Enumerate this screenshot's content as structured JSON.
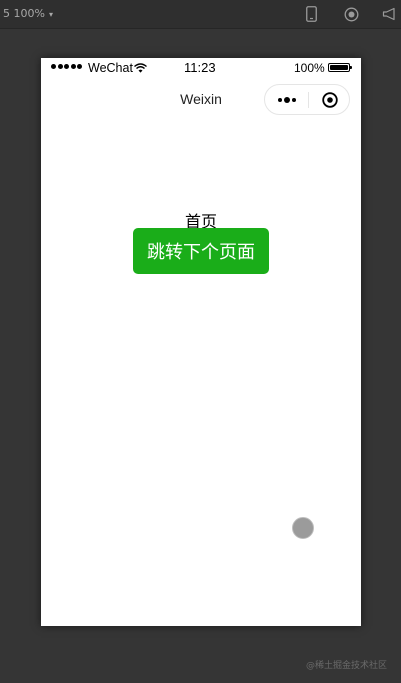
{
  "toolbar": {
    "zoom_label": "5 100%",
    "zoom_caret": "▾",
    "phone_icon": "phone-icon",
    "record_icon": "record-icon",
    "speaker_icon": "speaker-icon"
  },
  "statusbar": {
    "carrier": "WeChat",
    "time": "11:23",
    "battery_percent": "100%"
  },
  "navbar": {
    "title": "Weixin"
  },
  "page": {
    "heading": "首页",
    "jump_button_label": "跳转下个页面"
  },
  "watermark": "@稀土掘金技术社区",
  "colors": {
    "primary_button": "#1aad19",
    "background": "#353535",
    "device": "#ffffff"
  }
}
